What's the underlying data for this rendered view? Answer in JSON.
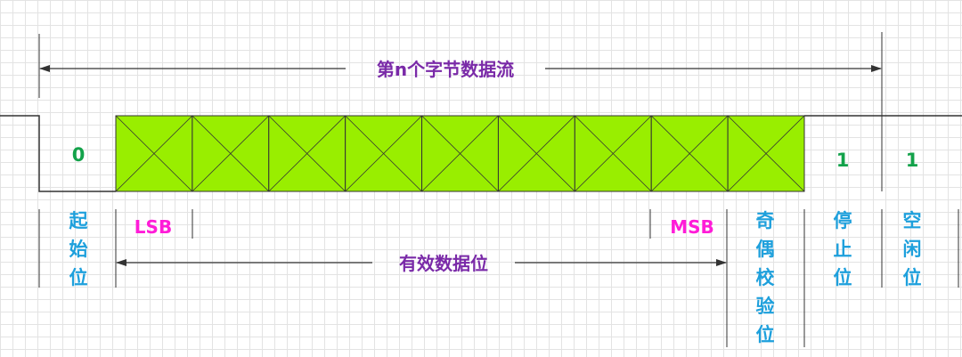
{
  "title": "第n个字节数据流",
  "data_bits_label": "有效数据位",
  "lsb_label": "LSB",
  "msb_label": "MSB",
  "start_bit": {
    "value": "0",
    "label": [
      "起",
      "始",
      "位"
    ]
  },
  "parity_bit": {
    "label": [
      "奇",
      "偶",
      "校",
      "验",
      "位"
    ]
  },
  "stop_bit": {
    "value": "1",
    "label": [
      "停",
      "止",
      "位"
    ]
  },
  "idle_bit": {
    "value": "1",
    "label": [
      "空",
      "闲",
      "位"
    ]
  },
  "data_bit_count": 9,
  "colors": {
    "cell_fill": "#99ee00",
    "line": "#333333",
    "value_text": "#13a24a",
    "field_label": "#1ea0dc",
    "bit_order": "#ff1cd8",
    "arrow_label": "#7a2aa8"
  }
}
